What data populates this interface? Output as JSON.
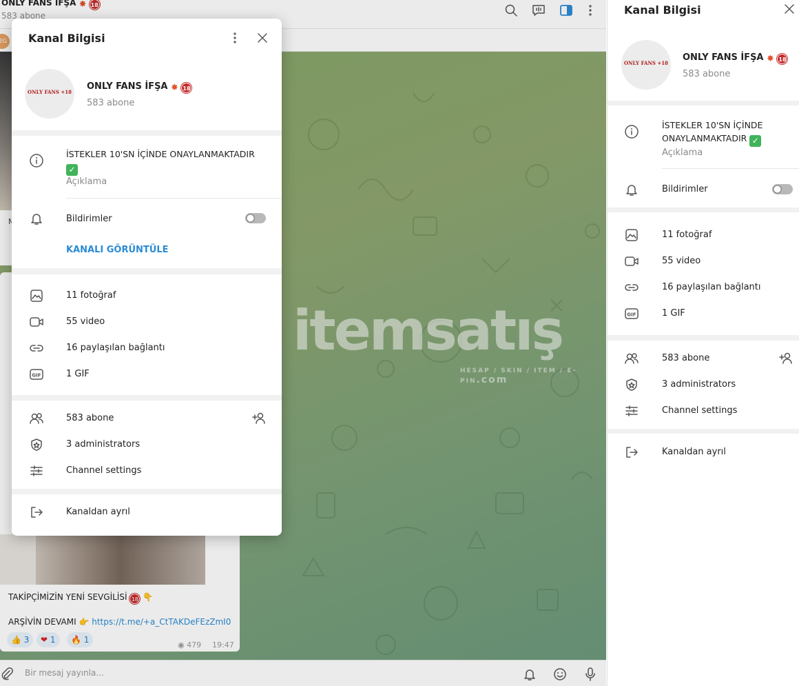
{
  "chat": {
    "title": "ONLY FANS İFŞA",
    "subscribers": "583 abone",
    "pinned_avatar": "EG",
    "top_msg_text": "M",
    "caption_line1": "TAKİPÇİMİZİN YENİ SEVGİLİSİ",
    "caption_line2_prefix": "ARŞİVİN DEVAMI",
    "caption_link": "https://t.me/+a_CtTAKDeFEzZmI0",
    "reactions": [
      {
        "emoji": "👍",
        "count": "3"
      },
      {
        "emoji": "❤",
        "count": "1"
      },
      {
        "emoji": "🔥",
        "count": "1"
      }
    ],
    "views": "479",
    "time": "19:47",
    "composer_placeholder": "Bir mesaj yayınla..."
  },
  "watermark": {
    "brand": "itemsatış",
    "tagline": "HESAP / SKIN / ITEM / E-PIN",
    "tld": ".com"
  },
  "modal": {
    "title": "Kanal Bilgisi",
    "avatar_text": "ONLY FANS +18",
    "channel_name": "ONLY FANS İFŞA",
    "subscribers": "583 abone",
    "description": "İSTEKLER 10'SN İÇİNDE ONAYLANMAKTADIR",
    "description_label": "Açıklama",
    "notifications_label": "Bildirimler",
    "view_channel_label": "KANALI GÖRÜNTÜLE",
    "media": {
      "photos": "11 fotoğraf",
      "videos": "55 video",
      "links": "16 paylaşılan bağlantı",
      "gifs": "1 GIF"
    },
    "members": {
      "subscribers": "583 abone",
      "admins": "3 administrators",
      "settings": "Channel settings"
    },
    "leave": "Kanaldan ayrıl"
  },
  "side": {
    "title": "Kanal Bilgisi",
    "avatar_text": "ONLY FANS +18",
    "channel_name": "ONLY FANS İFŞA",
    "subscribers": "583 abone",
    "description_line1": "İSTEKLER 10'SN İÇİNDE",
    "description_line2": "ONAYLANMAKTADIR",
    "description_label": "Açıklama",
    "notifications_label": "Bildirimler",
    "media": {
      "photos": "11 fotoğraf",
      "videos": "55 video",
      "links": "16 paylaşılan bağlantı",
      "gifs": "1 GIF"
    },
    "members": {
      "subscribers": "583 abone",
      "admins": "3 administrators",
      "settings": "Channel settings"
    },
    "leave": "Kanaldan ayrıl"
  },
  "colors": {
    "accent": "#2a8bd4",
    "chat_bg": "#86a86a"
  }
}
